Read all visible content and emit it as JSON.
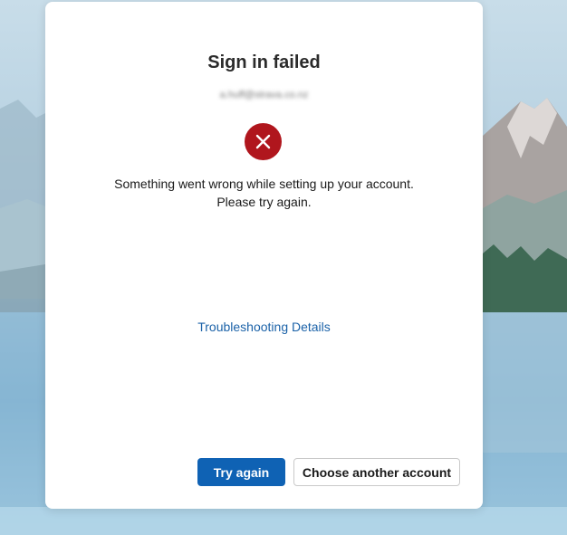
{
  "dialog": {
    "title": "Sign in failed",
    "email": "a.huff@strava.co.nz",
    "icon": "error-x-icon",
    "message": "Something went wrong while setting up your account. Please try again.",
    "troubleshooting_link": "Troubleshooting Details",
    "buttons": {
      "try_again": "Try again",
      "choose_another": "Choose another account"
    }
  },
  "colors": {
    "primary": "#0f62b4",
    "error": "#b0161d",
    "link": "#1b62a8"
  }
}
